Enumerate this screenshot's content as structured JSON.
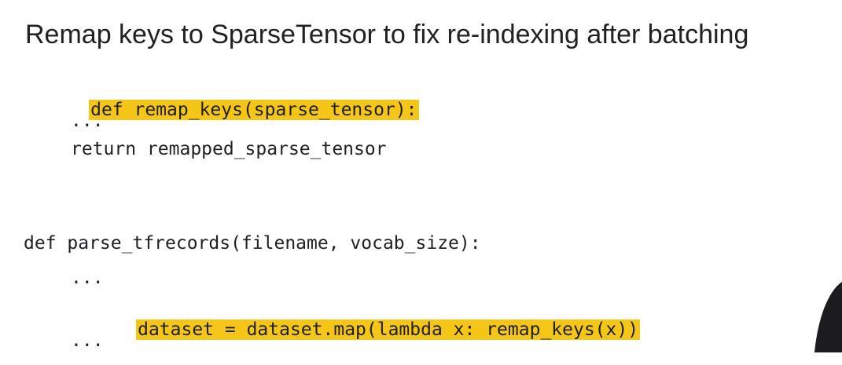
{
  "slide": {
    "title": "Remap keys to SparseTensor to fix re-indexing after batching"
  },
  "code": {
    "line1": "def remap_keys(sparse_tensor):",
    "line2": "...",
    "line3": "return remapped_sparse_tensor",
    "line4": "def parse_tfrecords(filename, vocab_size):",
    "line5": "...",
    "line6": "dataset = dataset.map(lambda x: remap_keys(x))",
    "line7": "..."
  },
  "colors": {
    "highlight": "#f5c518",
    "text": "#202124",
    "background": "#ffffff"
  }
}
